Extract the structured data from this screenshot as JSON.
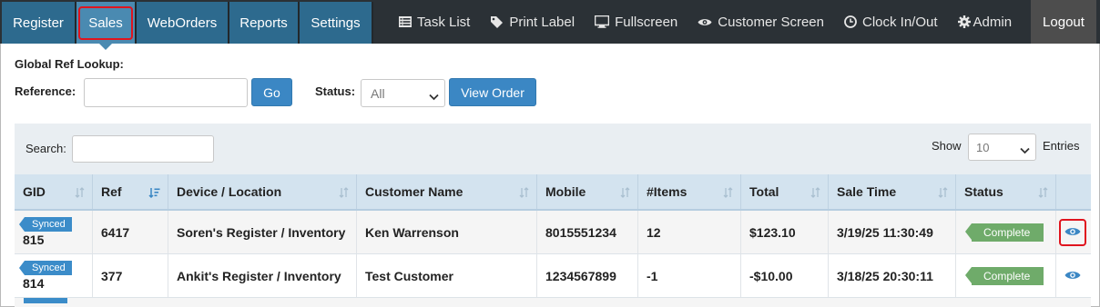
{
  "nav": {
    "tabs": [
      {
        "label": "Register"
      },
      {
        "label": "Sales"
      },
      {
        "label": "WebOrders"
      },
      {
        "label": "Reports"
      },
      {
        "label": "Settings"
      }
    ],
    "tools": [
      {
        "label": "Task List",
        "icon": "list-icon"
      },
      {
        "label": "Print Label",
        "icon": "tag-icon"
      },
      {
        "label": "Fullscreen",
        "icon": "monitor-icon"
      },
      {
        "label": "Customer Screen",
        "icon": "eye-icon"
      },
      {
        "label": "Clock In/Out",
        "icon": "clock-icon"
      },
      {
        "label": "Admin",
        "icon": "gear-icon"
      },
      {
        "label": "",
        "icon": "play-square-icon"
      }
    ],
    "logout": "Logout"
  },
  "lookup": {
    "title": "Global Ref Lookup:",
    "reference_label": "Reference:",
    "reference_value": "",
    "go_label": "Go",
    "status_label": "Status:",
    "status_selected": "All",
    "view_order_label": "View Order"
  },
  "table_controls": {
    "search_label": "Search:",
    "search_value": "",
    "show_label": "Show",
    "show_selected": "10",
    "entries_label": "Entries"
  },
  "table": {
    "columns": [
      "GID",
      "Ref",
      "Device / Location",
      "Customer Name",
      "Mobile",
      "#Items",
      "Total",
      "Sale Time",
      "Status",
      ""
    ],
    "rows": [
      {
        "synced": "Synced",
        "gid": "815",
        "ref": "6417",
        "device": "Soren's Register / Inventory",
        "customer": "Ken Warrenson",
        "mobile": "8015551234",
        "items": "12",
        "total": "$123.10",
        "sale_time": "3/19/25 11:30:49",
        "status": "Complete"
      },
      {
        "synced": "Synced",
        "gid": "814",
        "ref": "377",
        "device": "Ankit's Register / Inventory",
        "customer": "Test Customer",
        "mobile": "1234567899",
        "items": "-1",
        "total": "-$10.00",
        "sale_time": "3/18/25 20:30:11",
        "status": "Complete"
      }
    ]
  },
  "colors": {
    "nav_bg": "#2b3136",
    "tab_bg": "#2d6a8e",
    "tab_active": "#4a8ab1",
    "button_blue": "#3b87c4",
    "synced_blue": "#3b8cc9",
    "complete_green": "#6fab6a",
    "highlight_red": "#e0141e"
  }
}
